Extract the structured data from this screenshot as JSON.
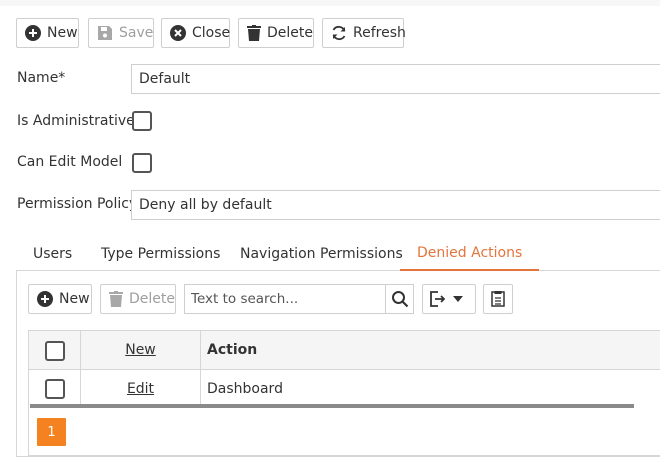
{
  "toolbar": {
    "new_label": "New",
    "save_label": "Save",
    "close_label": "Close",
    "delete_label": "Delete",
    "refresh_label": "Refresh"
  },
  "form": {
    "name_label": "Name*",
    "name_value": "Default",
    "is_admin_label": "Is Administrative",
    "is_admin_checked": false,
    "can_edit_label": "Can Edit Model",
    "can_edit_checked": false,
    "permission_label": "Permission Policy",
    "permission_value": "Deny all by default"
  },
  "tabs": [
    {
      "label": "Users",
      "active": false
    },
    {
      "label": "Type Permissions",
      "active": false
    },
    {
      "label": "Navigation Permissions",
      "active": false
    },
    {
      "label": "Denied Actions",
      "active": true
    }
  ],
  "detail_toolbar": {
    "new_label": "New",
    "delete_label": "Delete",
    "search_placeholder": "Text to search..."
  },
  "grid": {
    "header_new_link": "New",
    "header_action": "Action",
    "rows": [
      {
        "edit_link": "Edit",
        "action": "Dashboard"
      }
    ]
  },
  "pager": {
    "current_page": "1"
  },
  "colors": {
    "accent": "#e3743c",
    "pager_active": "#f58220",
    "border": "#cfcfcf"
  },
  "icons": [
    "plus-circle-icon",
    "save-icon",
    "close-circle-icon",
    "trash-icon",
    "refresh-icon",
    "search-icon",
    "export-icon",
    "chevron-down-icon",
    "column-chooser-icon"
  ]
}
